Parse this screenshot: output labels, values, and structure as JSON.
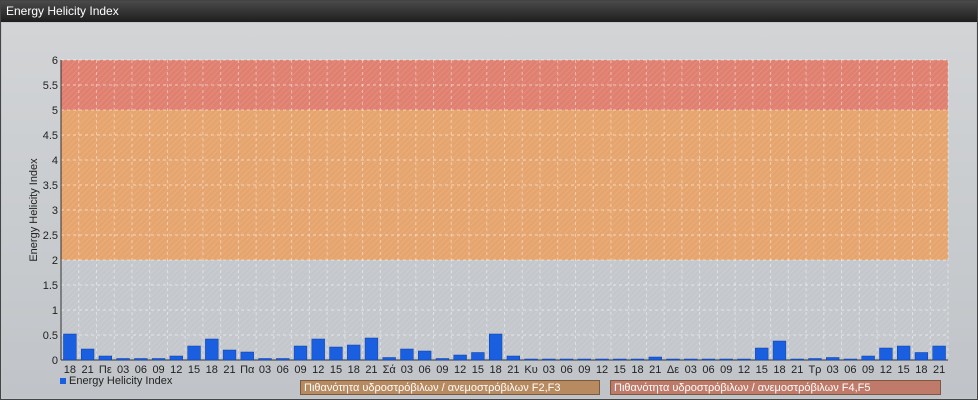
{
  "window": {
    "title": "Energy Helicity Index"
  },
  "chart_data": {
    "type": "bar",
    "title": "",
    "xlabel": "",
    "ylabel": "Energy Helicity Index",
    "ylim": [
      0,
      6
    ],
    "yticks": [
      "0",
      "0.5",
      "1",
      "1.5",
      "2",
      "2.5",
      "3",
      "3.5",
      "4",
      "4.5",
      "5",
      "5.5",
      "6"
    ],
    "grid": true,
    "categories": [
      "18",
      "21",
      "Πε",
      "03",
      "06",
      "09",
      "12",
      "15",
      "18",
      "21",
      "Πα",
      "03",
      "06",
      "09",
      "12",
      "15",
      "18",
      "21",
      "Σά",
      "03",
      "06",
      "09",
      "12",
      "15",
      "18",
      "21",
      "Κυ",
      "03",
      "06",
      "09",
      "12",
      "15",
      "18",
      "21",
      "Δε",
      "03",
      "06",
      "09",
      "12",
      "15",
      "18",
      "21",
      "Τρ",
      "03",
      "06",
      "09",
      "12",
      "15",
      "18",
      "21"
    ],
    "series": [
      {
        "name": "Energy Helicity Index",
        "values": [
          0.52,
          0.22,
          0.08,
          0.03,
          0.03,
          0.03,
          0.08,
          0.28,
          0.42,
          0.2,
          0.16,
          0.03,
          0.03,
          0.28,
          0.42,
          0.26,
          0.3,
          0.44,
          0.05,
          0.22,
          0.18,
          0.03,
          0.1,
          0.15,
          0.52,
          0.08,
          0.02,
          0.02,
          0.02,
          0.02,
          0.02,
          0.02,
          0.02,
          0.06,
          0.02,
          0.02,
          0.02,
          0.02,
          0.02,
          0.24,
          0.38,
          0.02,
          0.03,
          0.05,
          0.02,
          0.08,
          0.24,
          0.28,
          0.15,
          0.28
        ]
      }
    ],
    "bands": [
      {
        "from": 0,
        "to": 2,
        "color": "#c4c8cc"
      },
      {
        "from": 2,
        "to": 5,
        "color": "#e6a56e"
      },
      {
        "from": 5,
        "to": 6,
        "color": "#e08070"
      }
    ],
    "legend_position": "bottom-left",
    "series_color": "#1a5fe0"
  },
  "legend": {
    "series_label": "Energy Helicity Index",
    "band1_label": "Πιθανότητα υδροστρόβιλων / ανεμοστρόβιλων F2,F3",
    "band2_label": "Πιθανότητα υδροστρόβιλων / ανεμοστρόβιλων F4,F5",
    "band1_color": "#b88a60",
    "band2_color": "#c07a6a"
  }
}
